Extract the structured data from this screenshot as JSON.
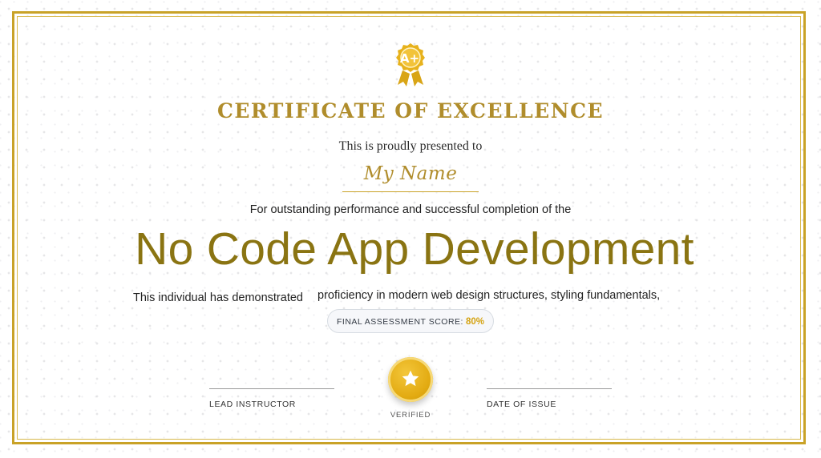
{
  "certificate": {
    "badge_icon": "a-plus-ribbon-icon",
    "badge_text": "A+",
    "title": "CERTIFICATE OF EXCELLENCE",
    "presented_text": "This is proudly presented to",
    "recipient_name": "My Name",
    "for_text": "For outstanding performance and successful completion of the",
    "course_name": "No Code App Development",
    "demonstrated_part1": "This individual has demonstrated",
    "demonstrated_part2": "proficiency in modern web design structures, styling fundamentals,",
    "score_label": "FINAL ASSESSMENT SCORE:",
    "score_value": "80%",
    "score_percent": 80,
    "lead_instructor_label": "LEAD INSTRUCTOR",
    "date_of_issue_label": "DATE OF ISSUE",
    "seal_icon": "star-icon",
    "verified_label": "VERIFIED"
  },
  "colors": {
    "gold_border": "#c9a227",
    "gold_title": "#b08d2c",
    "course_olive": "#8a7412",
    "score_gold": "#d4a20f",
    "seal_gold": "#e3ab12"
  }
}
